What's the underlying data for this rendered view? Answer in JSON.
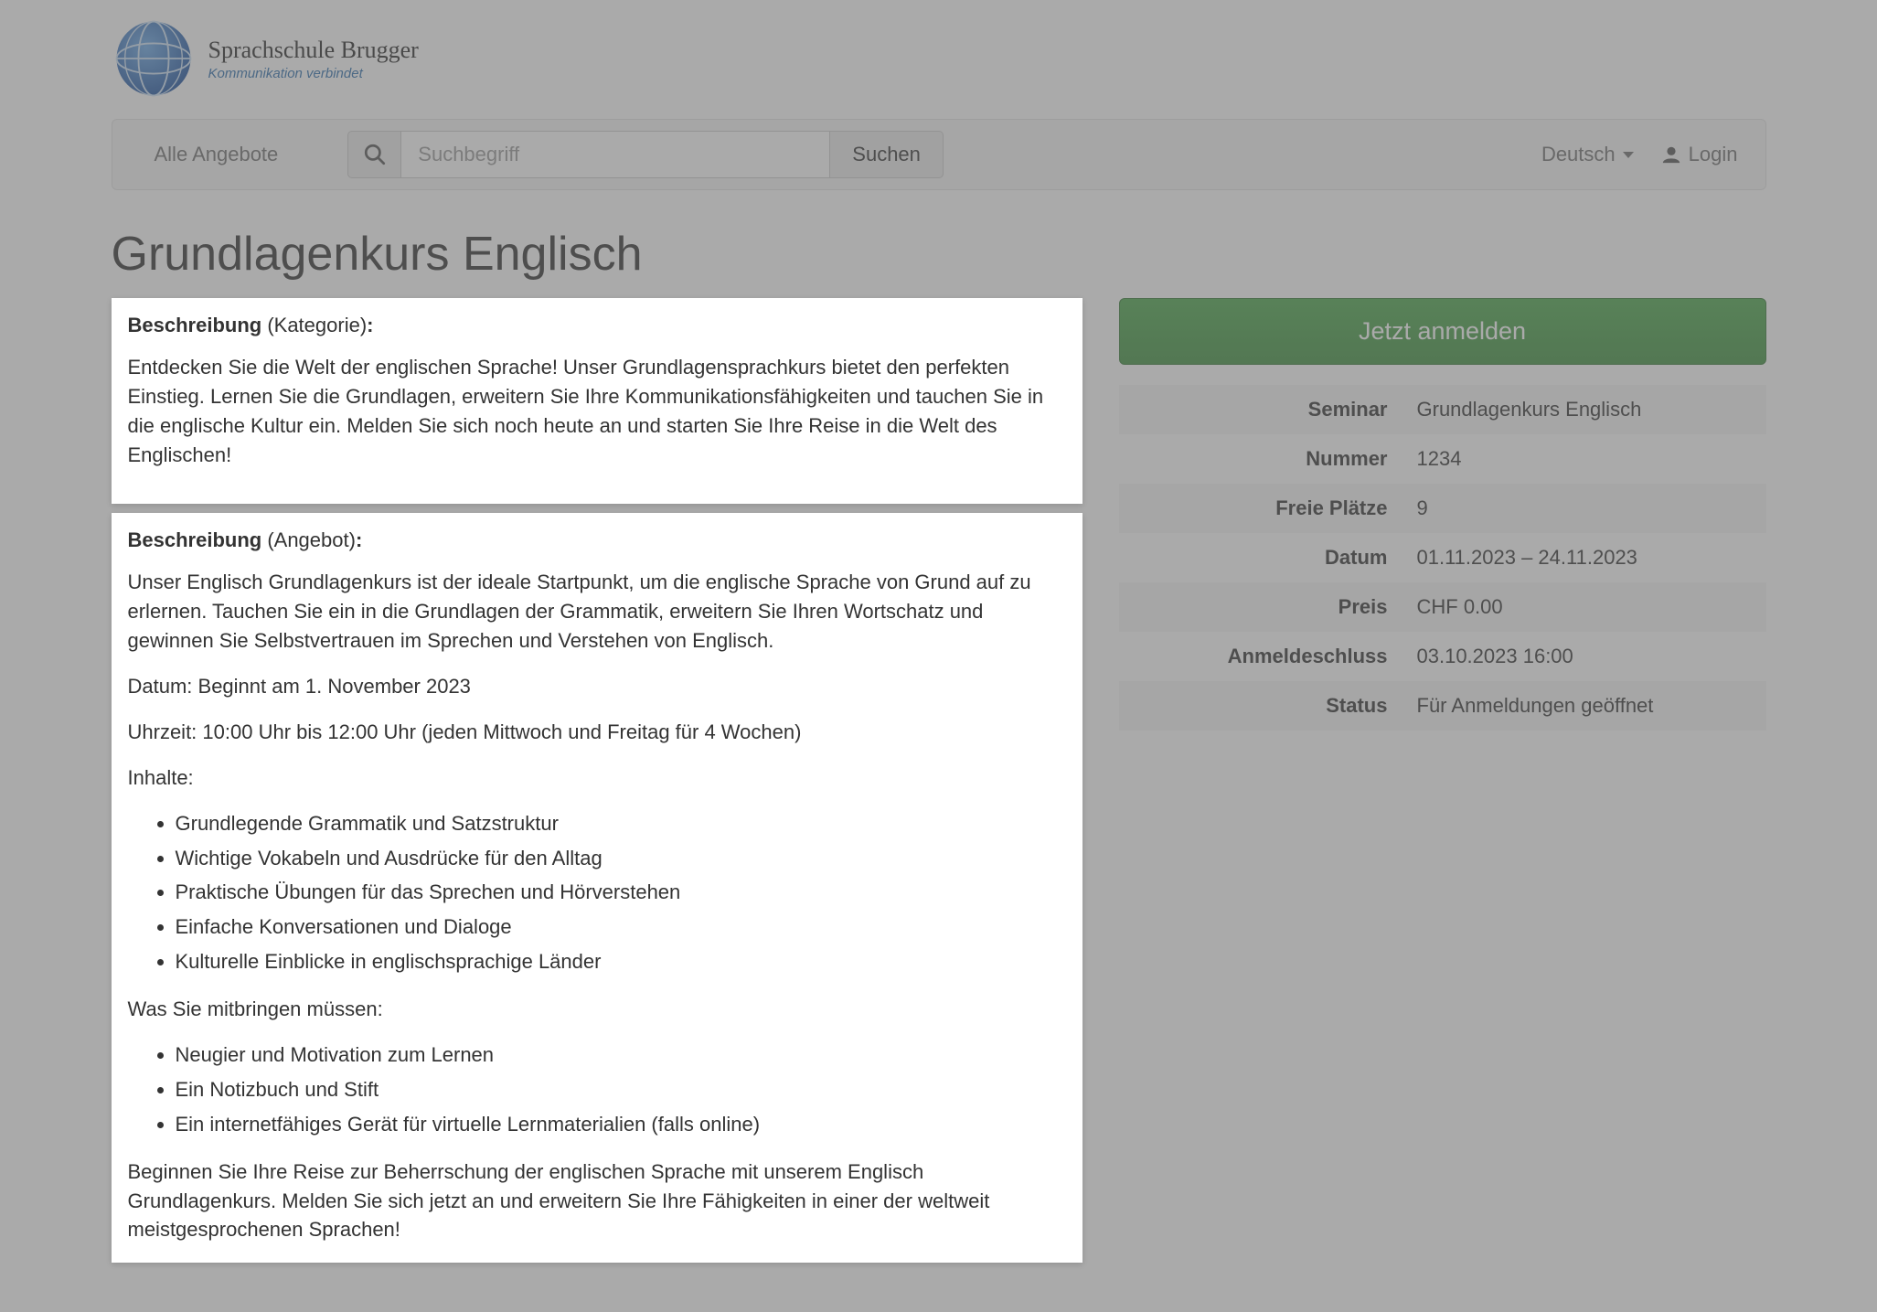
{
  "brand": {
    "title": "Sprachschule Brugger",
    "subtitle": "Kommunikation verbindet"
  },
  "nav": {
    "all_offers": "Alle Angebote",
    "search_placeholder": "Suchbegriff",
    "search_button": "Suchen",
    "language": "Deutsch",
    "login": "Login"
  },
  "page": {
    "title": "Grundlagenkurs Englisch"
  },
  "description_category": {
    "label_bold": "Beschreibung",
    "label_paren": " (Kategorie)",
    "label_colon": ":",
    "text": "Entdecken Sie die Welt der englischen Sprache! Unser Grundlagensprachkurs bietet den perfekten Einstieg. Lernen Sie die Grundlagen, erweitern Sie Ihre Kommunikationsfähigkeiten und tauchen Sie in die englische Kultur ein. Melden Sie sich noch heute an und starten Sie Ihre Reise in die Welt des Englischen!"
  },
  "description_offer": {
    "label_bold": "Beschreibung",
    "label_paren": " (Angebot)",
    "label_colon": ":",
    "intro": "Unser Englisch Grundlagenkurs ist der ideale Startpunkt, um die englische Sprache von Grund auf zu erlernen. Tauchen Sie ein in die Grundlagen der Grammatik, erweitern Sie Ihren Wortschatz und gewinnen Sie Selbstvertrauen im Sprechen und Verstehen von Englisch.",
    "date_line": "Datum: Beginnt am 1. November 2023",
    "time_line": "Uhrzeit: 10:00 Uhr bis 12:00 Uhr (jeden Mittwoch und Freitag für 4 Wochen)",
    "contents_label": "Inhalte:",
    "contents": [
      "Grundlegende Grammatik und Satzstruktur",
      "Wichtige Vokabeln und Ausdrücke für den Alltag",
      "Praktische Übungen für das Sprechen und Hörverstehen",
      "Einfache Konversationen und Dialoge",
      "Kulturelle Einblicke in englischsprachige Länder"
    ],
    "bring_label": "Was Sie mitbringen müssen:",
    "bring": [
      "Neugier und Motivation zum Lernen",
      "Ein Notizbuch und Stift",
      "Ein internetfähiges Gerät für virtuelle Lernmaterialien (falls online)"
    ],
    "outro": "Beginnen Sie Ihre Reise zur Beherrschung der englischen Sprache mit unserem Englisch Grundlagenkurs. Melden Sie sich jetzt an und erweitern Sie Ihre Fähigkeiten in einer der weltweit meistgesprochenen Sprachen!"
  },
  "sidebar": {
    "enroll_button": "Jetzt anmelden",
    "rows": [
      {
        "label": "Seminar",
        "value": "Grundlagenkurs Englisch"
      },
      {
        "label": "Nummer",
        "value": "1234"
      },
      {
        "label": "Freie Plätze",
        "value": "9"
      },
      {
        "label": "Datum",
        "value": "01.11.2023 – 24.11.2023"
      },
      {
        "label": "Preis",
        "value": "CHF 0.00"
      },
      {
        "label": "Anmeldeschluss",
        "value": "03.10.2023 16:00"
      },
      {
        "label": "Status",
        "value": "Für Anmeldungen geöffnet"
      }
    ]
  }
}
